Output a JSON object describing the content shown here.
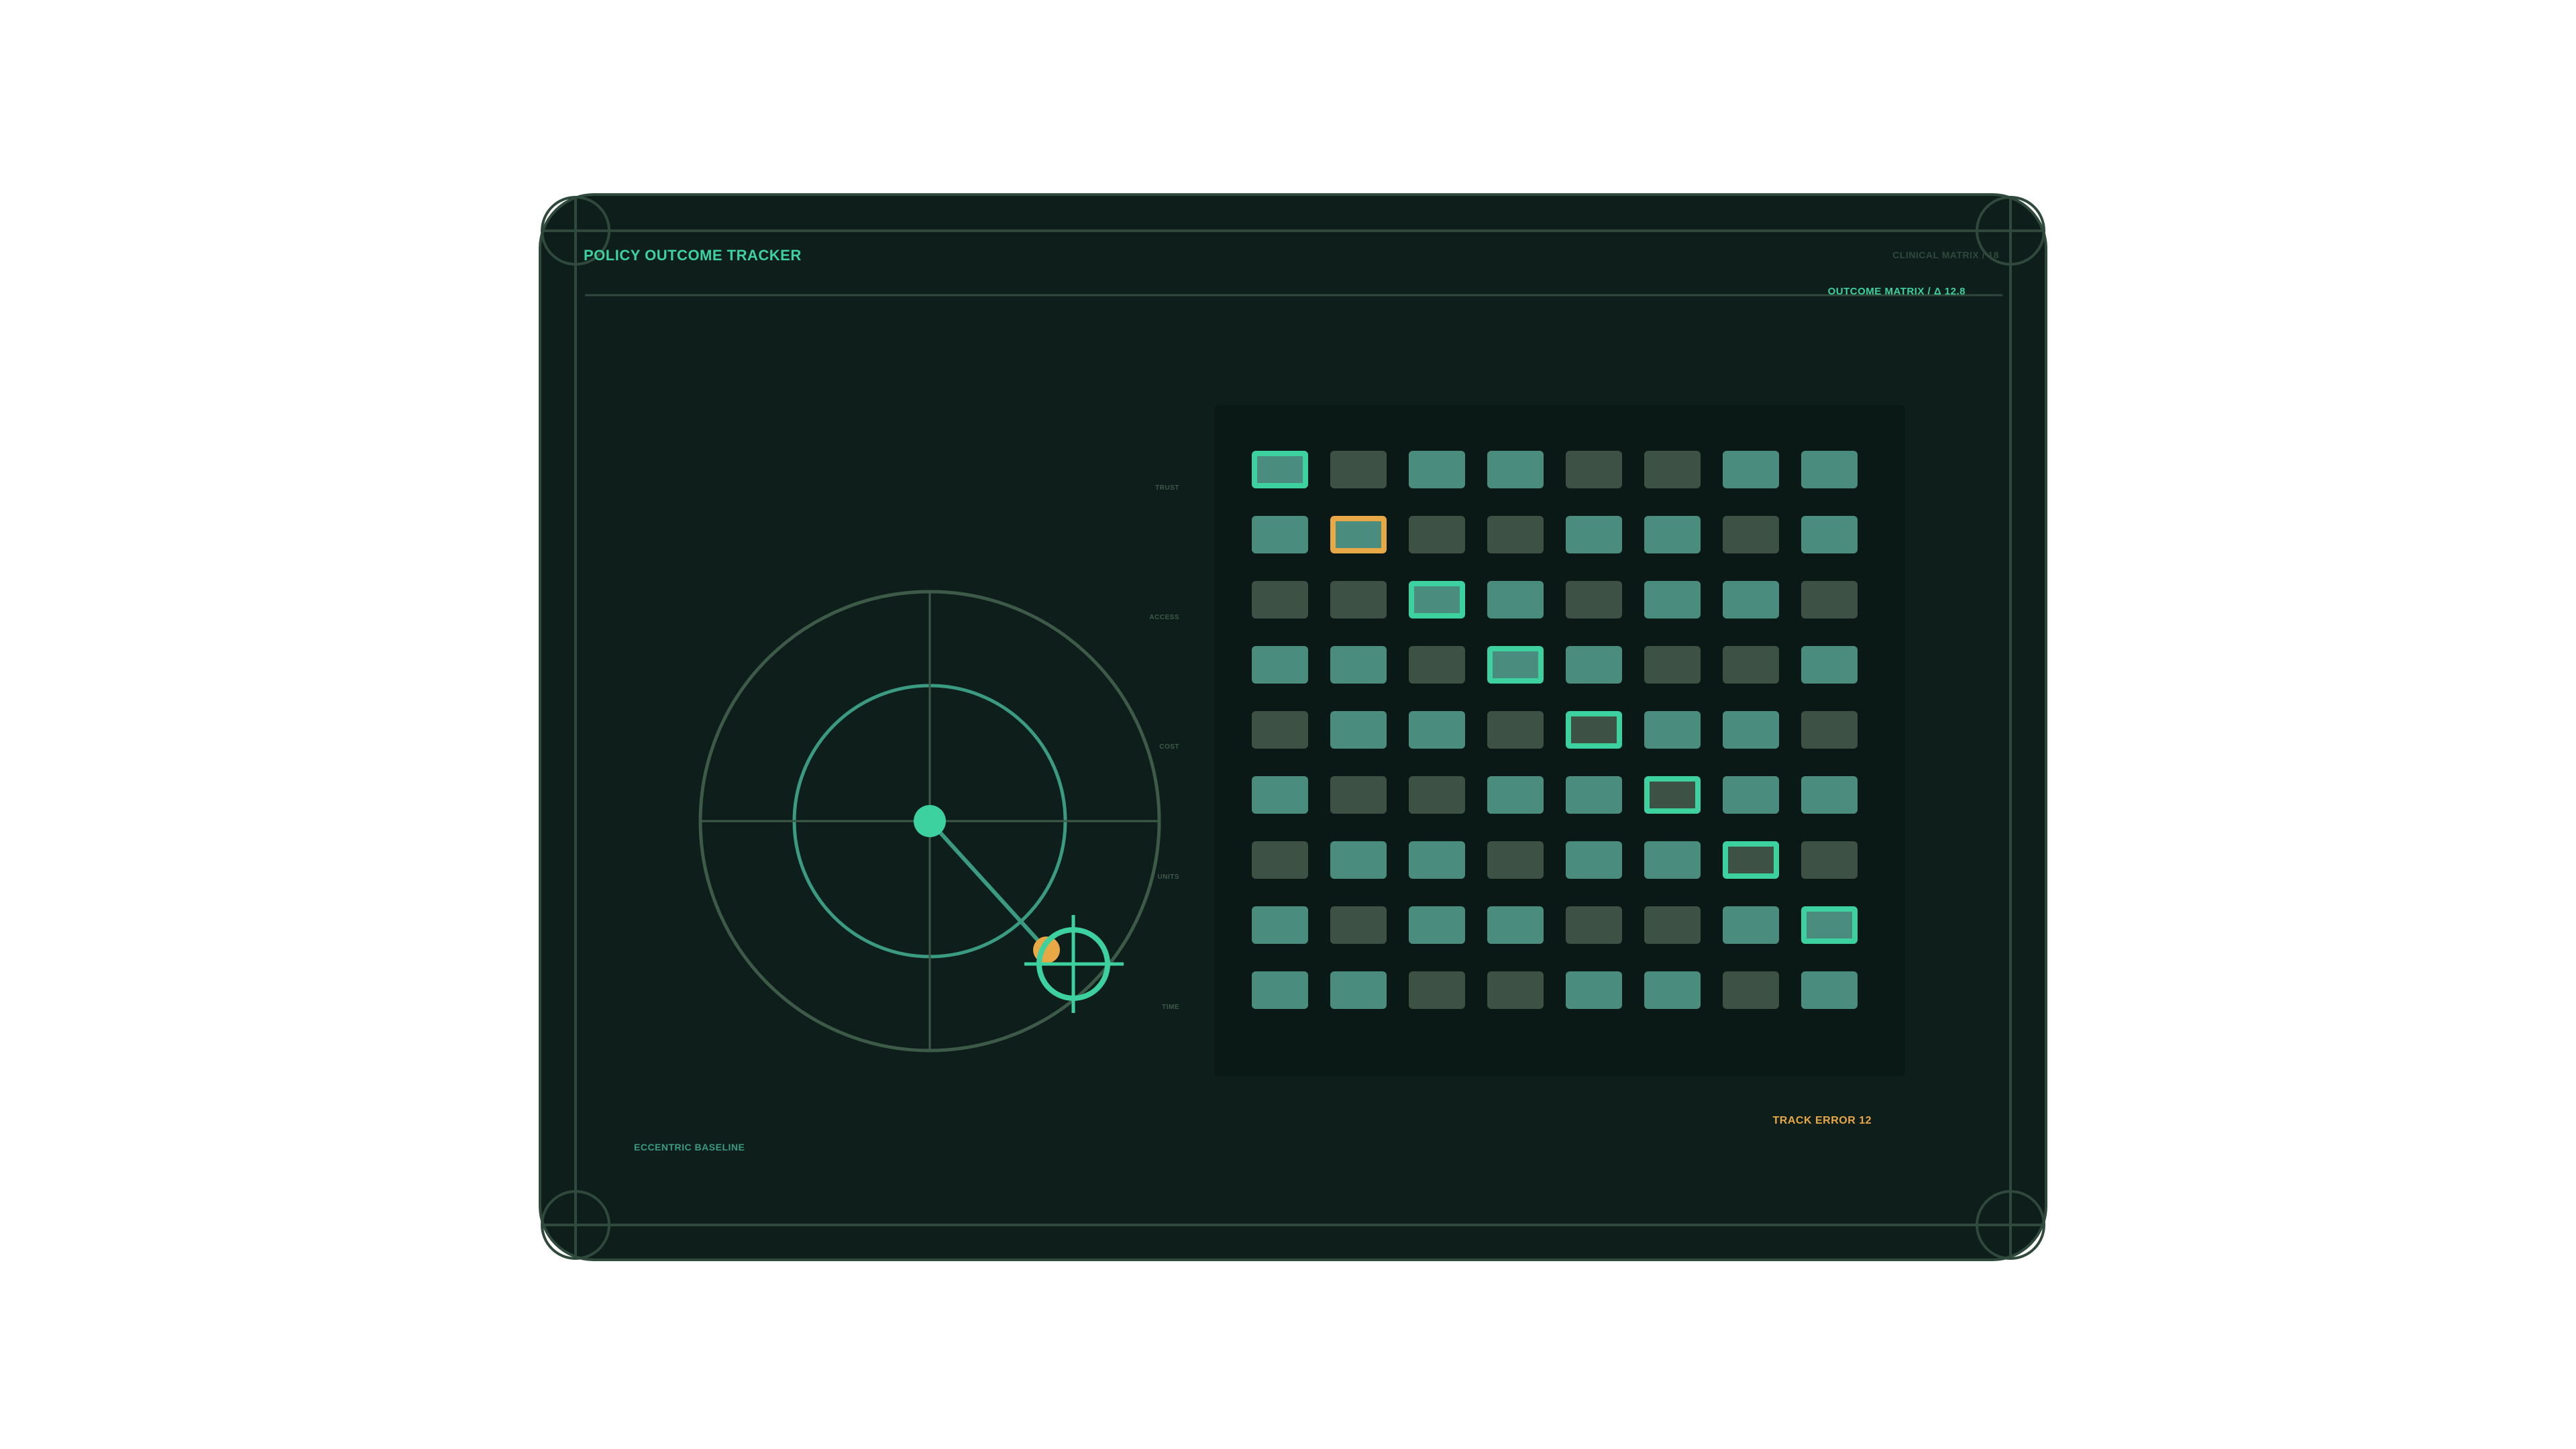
{
  "header": {
    "title": "POLICY OUTCOME TRACKER",
    "ref": "CLINICAL MATRIX / 18",
    "matrix_label": "OUTCOME MATRIX / Δ 12.8"
  },
  "axes": [
    "TRUST",
    "ACCESS",
    "COST",
    "UNITS",
    "TIME"
  ],
  "footer": {
    "baseline_label": "ECCENTRIC BASELINE",
    "track_error": "TRACK ERROR 12"
  },
  "colors": {
    "panel": "#0e1e1b",
    "frame": "#2f4a3c",
    "accent": "#3ed1a0",
    "cell_on": "#4a8d7f",
    "cell_off": "#3d5244",
    "warning": "#e8a845"
  },
  "matrix": {
    "rows": [
      [
        1,
        0,
        1,
        1,
        0,
        0,
        1,
        1
      ],
      [
        1,
        1,
        0,
        0,
        1,
        1,
        0,
        1
      ],
      [
        0,
        0,
        1,
        1,
        0,
        1,
        1,
        0
      ],
      [
        1,
        1,
        0,
        1,
        1,
        0,
        0,
        1
      ],
      [
        0,
        1,
        1,
        0,
        0,
        1,
        1,
        0
      ],
      [
        1,
        0,
        0,
        1,
        1,
        0,
        1,
        1
      ],
      [
        0,
        1,
        1,
        0,
        1,
        1,
        0,
        0
      ],
      [
        1,
        0,
        1,
        1,
        0,
        0,
        1,
        1
      ],
      [
        1,
        1,
        0,
        0,
        1,
        1,
        0,
        1
      ]
    ],
    "highlighted": [
      {
        "row": 0,
        "col": 0,
        "tone": "accent"
      },
      {
        "row": 1,
        "col": 1,
        "tone": "warning"
      },
      {
        "row": 2,
        "col": 2,
        "tone": "accent"
      },
      {
        "row": 3,
        "col": 3,
        "tone": "accent"
      },
      {
        "row": 4,
        "col": 4,
        "tone": "accent"
      },
      {
        "row": 5,
        "col": 5,
        "tone": "accent"
      },
      {
        "row": 6,
        "col": 6,
        "tone": "accent"
      },
      {
        "row": 7,
        "col": 7,
        "tone": "accent"
      }
    ]
  }
}
